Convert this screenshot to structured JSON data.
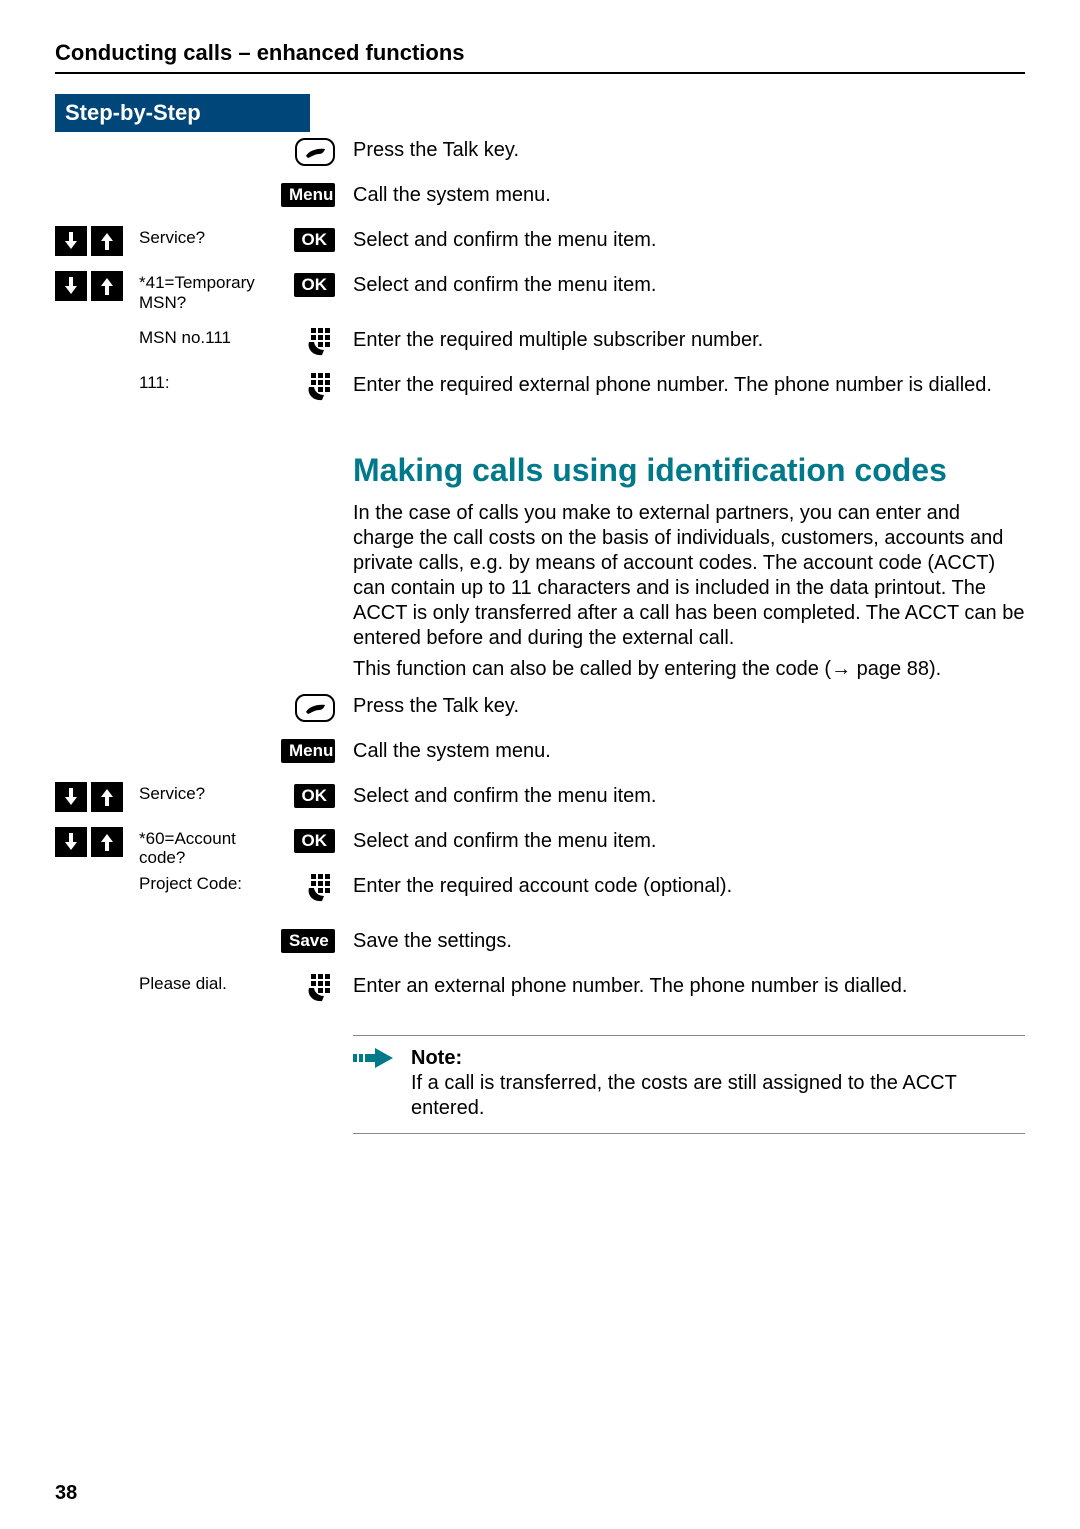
{
  "chapter_title": "Conducting calls – enhanced functions",
  "steps_header": "Step-by-Step",
  "labels": {
    "menu": "Menu",
    "ok": "OK",
    "save": "Save",
    "note": "Note:"
  },
  "section1": {
    "rows": [
      {
        "text": "Press the Talk key."
      },
      {
        "text": "Call the system menu."
      },
      {
        "display": "Service?",
        "text": "Select and confirm the menu item."
      },
      {
        "display": "*41=Temporary MSN?",
        "text": "Select and confirm the menu item."
      },
      {
        "display": "MSN no.111",
        "text": "Enter the required multiple subscriber number."
      },
      {
        "display": "111:",
        "text": "Enter the required external phone number. The phone number is dialled."
      }
    ]
  },
  "section2": {
    "heading": "Making calls using identification codes",
    "para1": "In the case of calls you make to external partners, you can enter and charge the call costs on the basis of individuals, customers, accounts and private calls, e.g.  by means of account codes. The account code (ACCT) can contain up to 11 characters and is included in the data printout. The ACCT is only transferred after a call has been completed. The ACCT can be entered before and during the external call.",
    "para2_a": "This function can also be called by entering the code (",
    "para2_ref": "page 88",
    "para2_b": ").",
    "rows": [
      {
        "text": "Press the Talk key."
      },
      {
        "text": "Call the system menu."
      },
      {
        "display": "Service?",
        "text": "Select and confirm the menu item."
      },
      {
        "display": "*60=Account code?",
        "text": "Select and confirm the menu item."
      },
      {
        "display": "Project Code:",
        "text": "Enter the required account code (optional)."
      },
      {
        "text": "Save the settings."
      },
      {
        "display": "Please dial.",
        "text": "Enter an external phone number. The phone number is dialled."
      }
    ],
    "note_text": "If a call is transferred, the costs are still assigned to the ACCT entered."
  },
  "page_number": "38"
}
